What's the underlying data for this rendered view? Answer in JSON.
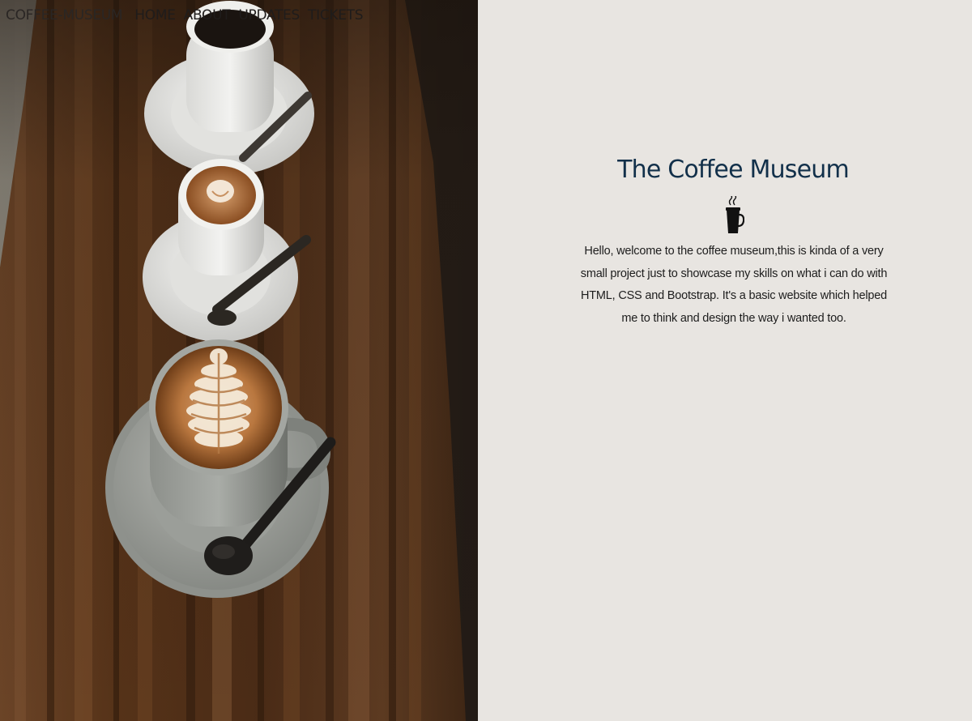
{
  "nav": {
    "brand": "COFFEE-MUSEUM",
    "links": [
      {
        "label": "HOME"
      },
      {
        "label": "ABOUT"
      },
      {
        "label": "UPDATES"
      },
      {
        "label": "TICKETS"
      }
    ]
  },
  "hero": {
    "title": "The Coffee Museum",
    "icon": "coffee-cup-icon",
    "description": "Hello, welcome to the coffee museum,this is kinda of a very small project just to showcase my skills on what i can do with HTML, CSS and Bootstrap. It's a basic website which helped me to think and design the way i wanted too."
  },
  "photo": {
    "subject": "coffee-cups-on-wooden-table"
  },
  "colors": {
    "background": "#e8e5e1",
    "title": "#12304a",
    "wood": "#4a2c18"
  }
}
